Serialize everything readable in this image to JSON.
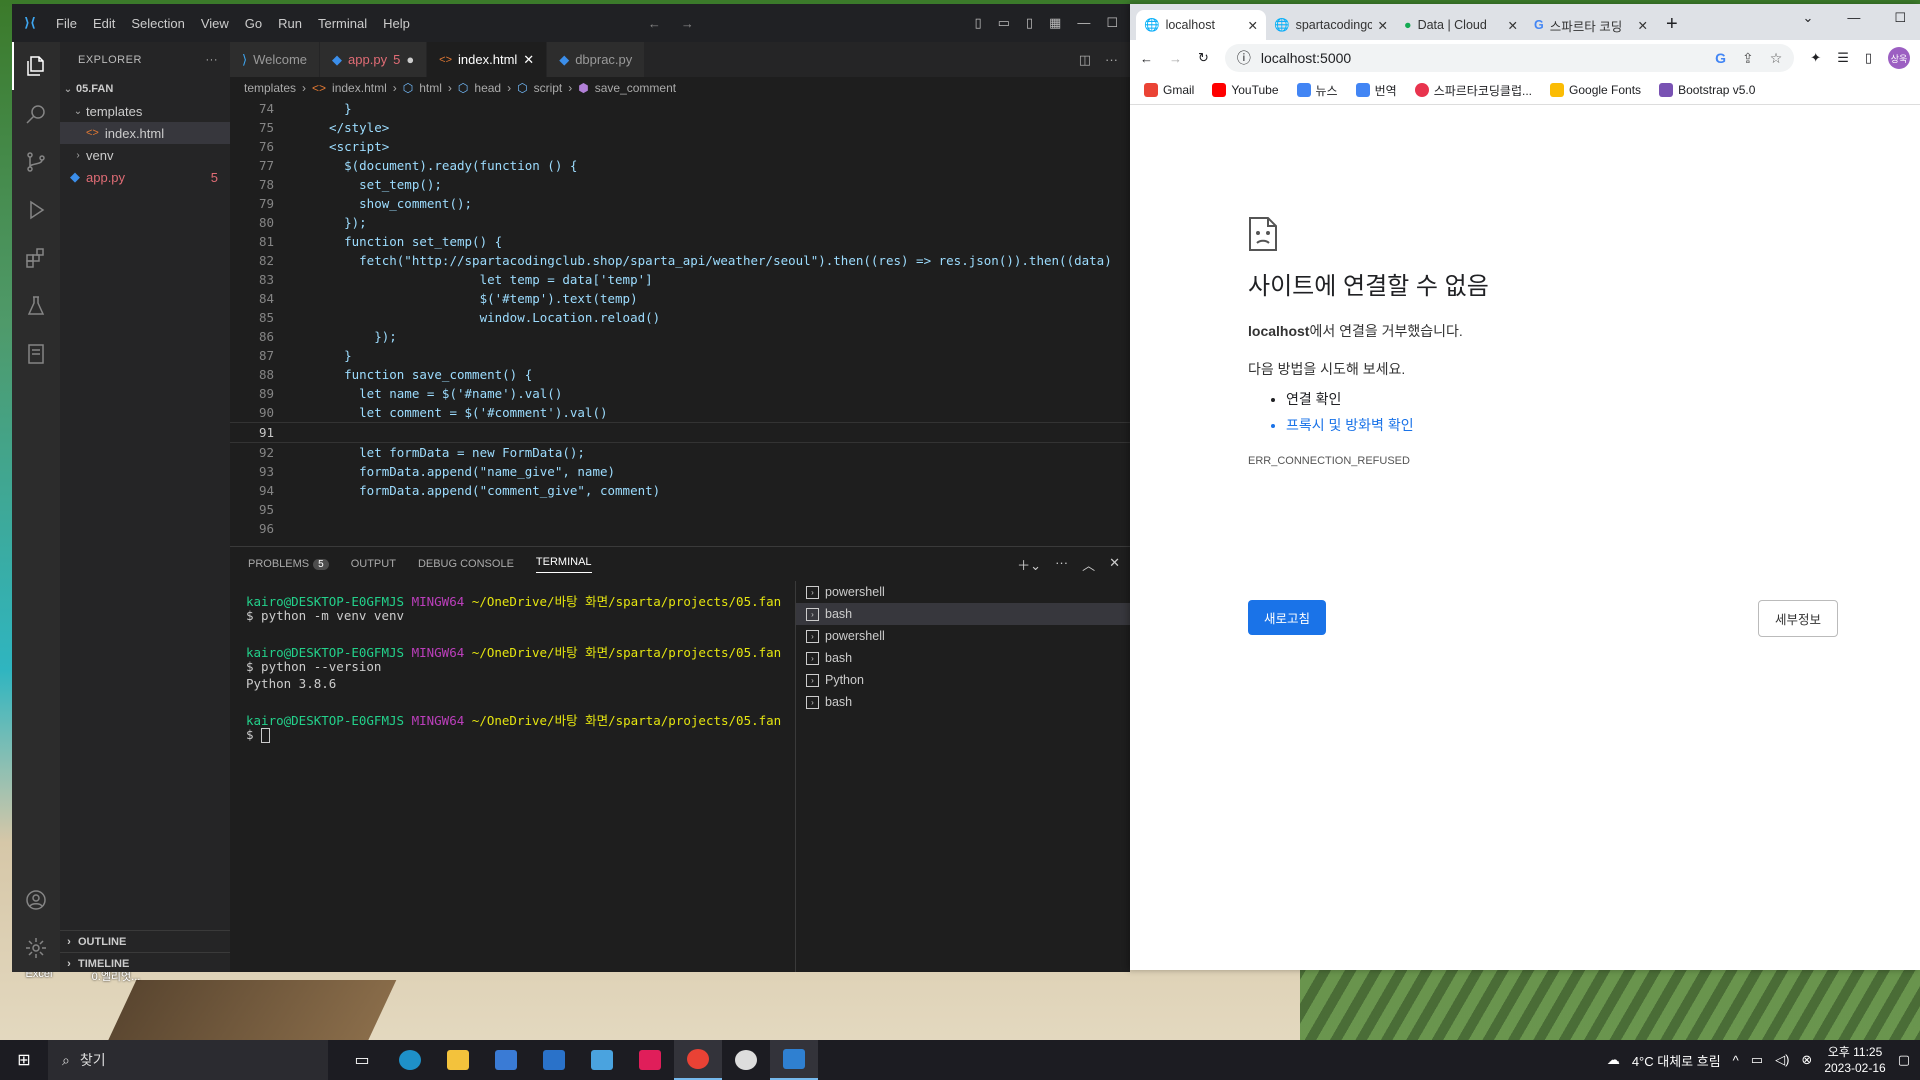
{
  "desktop": {
    "icons": [
      {
        "label": "Excel"
      },
      {
        "label": "0.엘리엇..."
      }
    ]
  },
  "vscode": {
    "menu": [
      "File",
      "Edit",
      "Selection",
      "View",
      "Go",
      "Run",
      "Terminal",
      "Help"
    ],
    "explorer": {
      "title": "EXPLORER",
      "root": "05.FAN",
      "items": [
        {
          "label": "templates",
          "type": "folder"
        },
        {
          "label": "index.html",
          "type": "file"
        },
        {
          "label": "venv",
          "type": "folder"
        },
        {
          "label": "app.py",
          "type": "file",
          "badge": "5"
        }
      ],
      "outline": "OUTLINE",
      "timeline": "TIMELINE"
    },
    "activity_badge": "1",
    "tabs": [
      {
        "label": "Welcome"
      },
      {
        "label": "app.py",
        "badge": "5"
      },
      {
        "label": "index.html"
      },
      {
        "label": "dbprac.py"
      }
    ],
    "breadcrumb": [
      "templates",
      "index.html",
      "html",
      "head",
      "script",
      "save_comment"
    ],
    "code_lines": [
      {
        "n": "74",
        "t": "    }"
      },
      {
        "n": "75",
        "t": "  </style>"
      },
      {
        "n": "76",
        "t": "  <script>"
      },
      {
        "n": "77",
        "t": "    $(document).ready(function () {"
      },
      {
        "n": "78",
        "t": "      set_temp();"
      },
      {
        "n": "79",
        "t": "      show_comment();"
      },
      {
        "n": "80",
        "t": "    });"
      },
      {
        "n": "81",
        "t": "    function set_temp() {"
      },
      {
        "n": "82",
        "t": "      fetch(\"http://spartacodingclub.shop/sparta_api/weather/seoul\").then((res) => res.json()).then((data)"
      },
      {
        "n": "83",
        "t": "                      let temp = data['temp']"
      },
      {
        "n": "84",
        "t": "                      $('#temp').text(temp)"
      },
      {
        "n": "85",
        "t": "                      window.Location.reload()"
      },
      {
        "n": "86",
        "t": "        });"
      },
      {
        "n": "87",
        "t": "    }"
      },
      {
        "n": "88",
        "t": "    function save_comment() {"
      },
      {
        "n": "89",
        "t": "      let name = $('#name').val()"
      },
      {
        "n": "90",
        "t": "      let comment = $('#comment').val()"
      },
      {
        "n": "91",
        "t": ""
      },
      {
        "n": "92",
        "t": "      let formData = new FormData();"
      },
      {
        "n": "93",
        "t": "      formData.append(\"name_give\", name)"
      },
      {
        "n": "94",
        "t": "      formData.append(\"comment_give\", comment)"
      },
      {
        "n": "95",
        "t": ""
      },
      {
        "n": "96",
        "t": ""
      }
    ],
    "panel_tabs": [
      {
        "label": "PROBLEMS",
        "badge": "5"
      },
      {
        "label": "OUTPUT"
      },
      {
        "label": "DEBUG CONSOLE"
      },
      {
        "label": "TERMINAL"
      }
    ],
    "terminal": {
      "user": "kairo@DESKTOP-E0GFMJS",
      "shell": "MINGW64",
      "path": "~/OneDrive/바탕 화면/sparta/projects/05.fan",
      "cmd1": "$ python -m venv venv",
      "cmd2": "$ python --version",
      "out2": "Python 3.8.6",
      "prompt": "$ "
    },
    "terminal_list": [
      "powershell",
      "bash",
      "powershell",
      "bash",
      "Python",
      "bash"
    ]
  },
  "chrome": {
    "tabs": [
      {
        "label": "localhost"
      },
      {
        "label": "spartacodingc"
      },
      {
        "label": "Data | Cloud"
      },
      {
        "label": "스파르타 코딩"
      }
    ],
    "url": "localhost:5000",
    "avatar": "상욱",
    "bookmarks": [
      {
        "label": "Gmail",
        "color": "#ea4335"
      },
      {
        "label": "YouTube",
        "color": "#ff0000"
      },
      {
        "label": "뉴스",
        "color": "#4285f4"
      },
      {
        "label": "번역",
        "color": "#4285f4"
      },
      {
        "label": "스파르타코딩클럽...",
        "color": "#e8344e"
      },
      {
        "label": "Google Fonts",
        "color": "#fbbc04"
      },
      {
        "label": "Bootstrap v5.0",
        "color": "#7952b3"
      }
    ],
    "error": {
      "title": "사이트에 연결할 수 없음",
      "host": "localhost",
      "host_suffix": "에서 연결을 거부했습니다.",
      "try_label": "다음 방법을 시도해 보세요.",
      "suggestion1": "연결 확인",
      "suggestion2": "프록시 및 방화벽 확인",
      "code": "ERR_CONNECTION_REFUSED",
      "reload": "새로고침",
      "details": "세부정보"
    }
  },
  "taskbar": {
    "search": "찾기",
    "weather": "4°C  대체로 흐림",
    "time": "오후 11:25",
    "date": "2023-02-16"
  }
}
